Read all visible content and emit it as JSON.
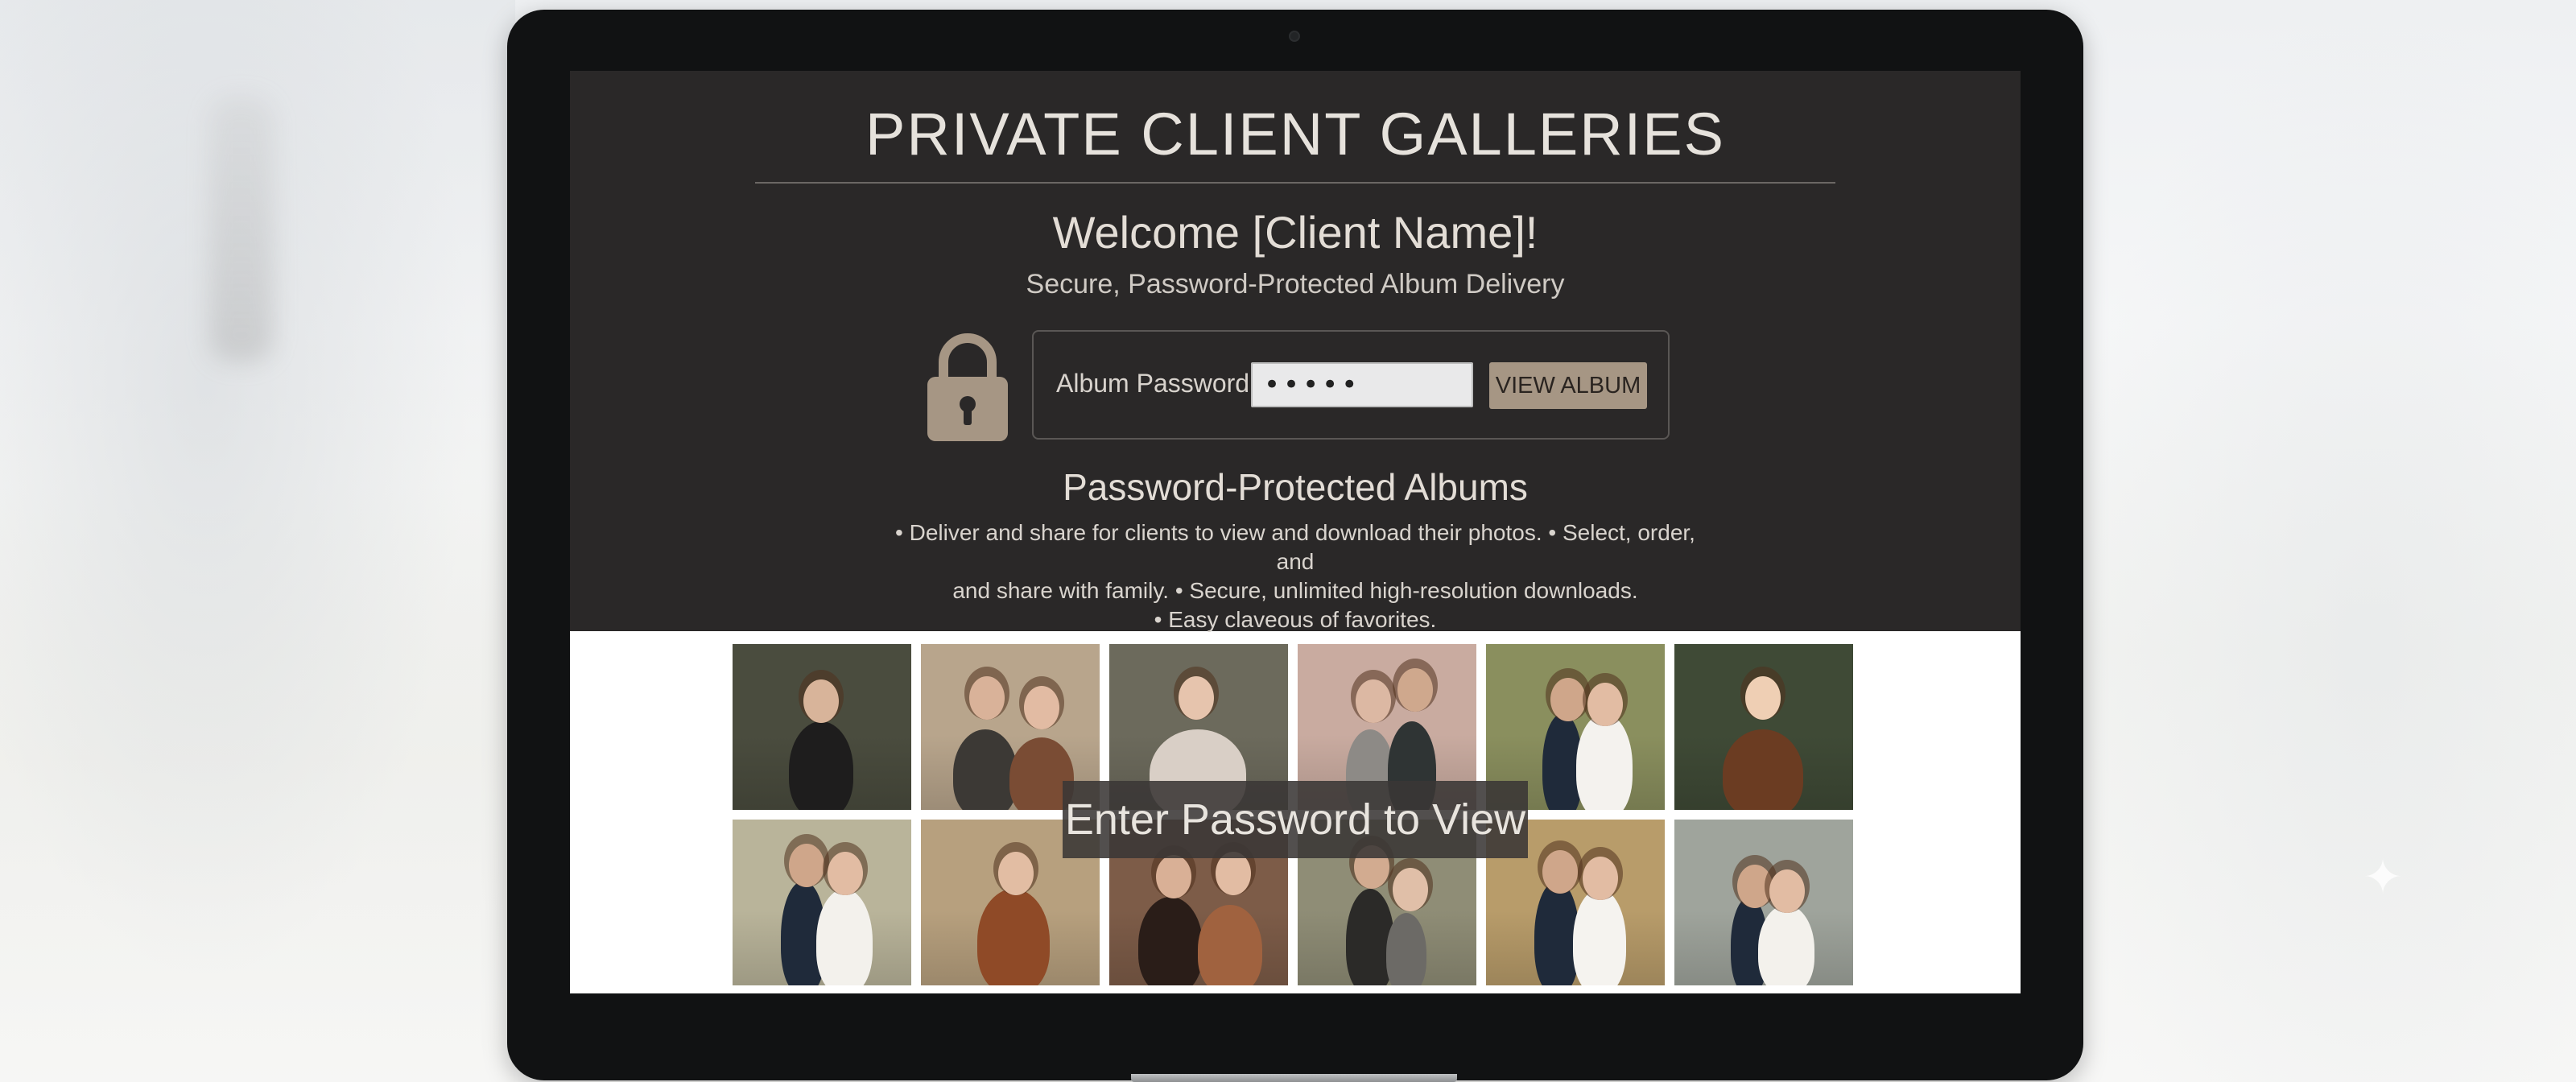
{
  "page": {
    "title": "PRIVATE CLIENT GALLERIES",
    "welcome": "Welcome [Client Name]!",
    "subtitle": "Secure, Password-Protected Album Delivery"
  },
  "login": {
    "label": "Album Password:",
    "password_value": "•••••",
    "button_label": "VIEW ALBUM",
    "lock_icon": "padlock-icon"
  },
  "albums": {
    "heading": "Password-Protected Albums",
    "line1": "• Deliver and share for clients to view and download their photos. • Select, order, and",
    "line2": "and share with family.  • Secure, unlimited high-resolution downloads.",
    "line3": "• Easy claveous of favorites."
  },
  "gallery": {
    "overlay_text": "Enter Password to View",
    "photos": [
      {
        "subject": "woman portrait, dark sweater",
        "bg": "#4a4c3e"
      },
      {
        "subject": "couple embracing in field",
        "bg": "#b8a58c"
      },
      {
        "subject": "bride with veil smiling",
        "bg": "#6c6a5c"
      },
      {
        "subject": "couple in front of pink wall",
        "bg": "#c9aba0"
      },
      {
        "subject": "wedding couple among trees",
        "bg": "#8a8f5e"
      },
      {
        "subject": "woman in front of leaves",
        "bg": "#3f4a36"
      },
      {
        "subject": "wedding couple kissing by tree",
        "bg": "#b9b49a"
      },
      {
        "subject": "woman in rust sweater in field",
        "bg": "#b7a07e"
      },
      {
        "subject": "two women hugging",
        "bg": "#7d5c48"
      },
      {
        "subject": "family with child in field",
        "bg": "#8f8d76"
      },
      {
        "subject": "wedding couple at sunset",
        "bg": "#b89c6a"
      },
      {
        "subject": "wedding couple in landscape",
        "bg": "#9fa49c"
      }
    ]
  },
  "colors": {
    "panel_bg": "#2a2828",
    "accent_button": "#a69684",
    "text_light": "#e3ddd6"
  }
}
